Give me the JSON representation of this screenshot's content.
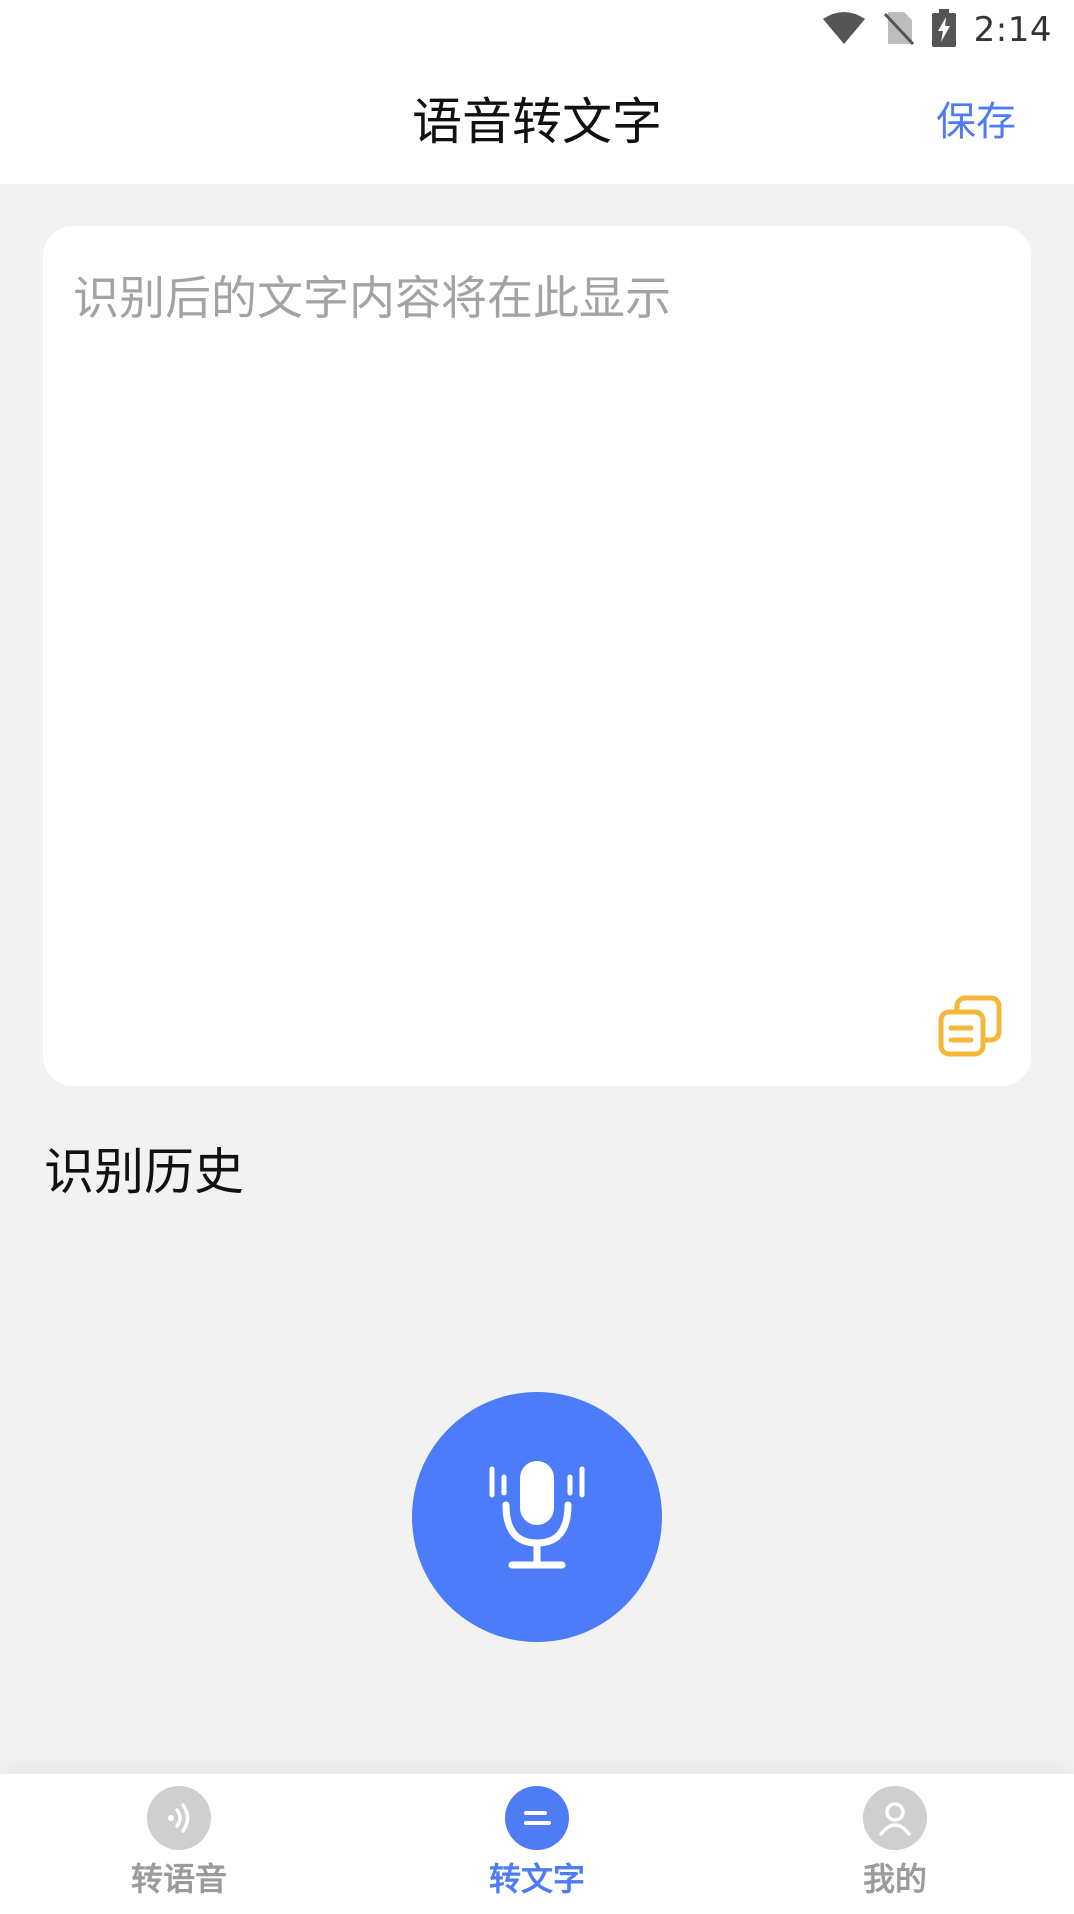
{
  "status_bar": {
    "time": "2:14",
    "icons": [
      "wifi-icon",
      "no-sim-icon",
      "battery-charging-icon"
    ]
  },
  "header": {
    "title": "语音转文字",
    "save_label": "保存"
  },
  "text_card": {
    "placeholder": "识别后的文字内容将在此显示",
    "value": "",
    "copy_icon": "copy-icon"
  },
  "history": {
    "title": "识别历史"
  },
  "mic": {
    "icon": "microphone-icon"
  },
  "bottom_nav": {
    "items": [
      {
        "label": "转语音",
        "icon": "sound-wave-icon",
        "active": false
      },
      {
        "label": "转文字",
        "icon": "text-lines-icon",
        "active": true
      },
      {
        "label": "我的",
        "icon": "user-icon",
        "active": false
      }
    ]
  },
  "colors": {
    "accent": "#4d7cf5",
    "copy_icon": "#f4b73a",
    "inactive": "#9b9b9b",
    "background": "#f2f2f3"
  }
}
